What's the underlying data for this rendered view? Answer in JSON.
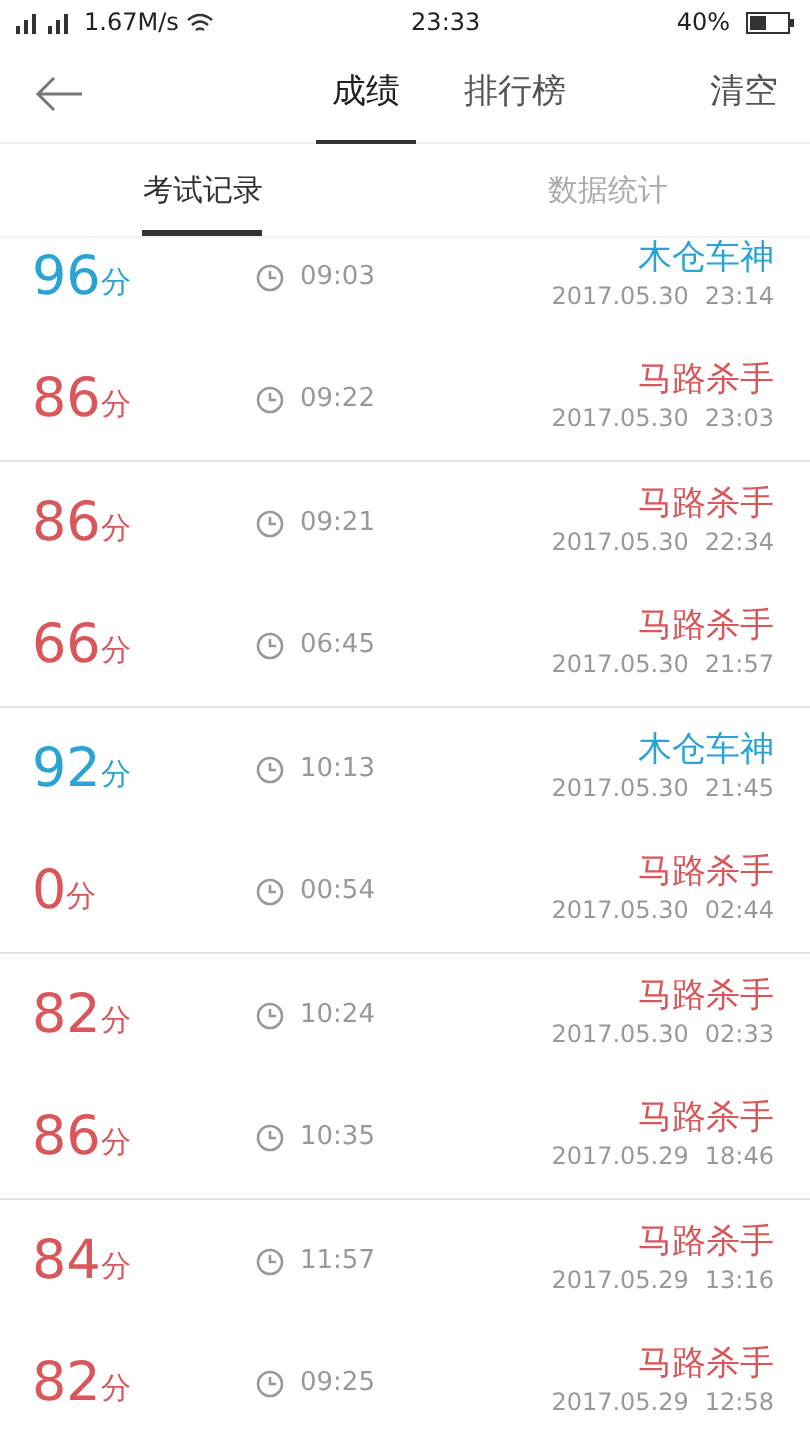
{
  "status_bar": {
    "speed": "1.67M/s",
    "time": "23:33",
    "battery": "40%"
  },
  "header": {
    "tabs": [
      {
        "label": "成绩",
        "selected": true
      },
      {
        "label": "排行榜",
        "selected": false
      }
    ],
    "action": "清空"
  },
  "sub_tabs": [
    {
      "label": "考试记录",
      "selected": true
    },
    {
      "label": "数据统计",
      "selected": false
    }
  ],
  "groups": [
    [
      {
        "score": "96",
        "unit": "分",
        "duration": "09:03",
        "name": "木仓车神",
        "date": "2017.05.30",
        "time": "23:14",
        "color": "#2ba3d4"
      },
      {
        "score": "86",
        "unit": "分",
        "duration": "09:22",
        "name": "马路杀手",
        "date": "2017.05.30",
        "time": "23:03",
        "color": "#d9575a"
      }
    ],
    [
      {
        "score": "86",
        "unit": "分",
        "duration": "09:21",
        "name": "马路杀手",
        "date": "2017.05.30",
        "time": "22:34",
        "color": "#d9575a"
      },
      {
        "score": "66",
        "unit": "分",
        "duration": "06:45",
        "name": "马路杀手",
        "date": "2017.05.30",
        "time": "21:57",
        "color": "#d9575a"
      }
    ],
    [
      {
        "score": "92",
        "unit": "分",
        "duration": "10:13",
        "name": "木仓车神",
        "date": "2017.05.30",
        "time": "21:45",
        "color": "#2ba3d4"
      },
      {
        "score": "0",
        "unit": "分",
        "duration": "00:54",
        "name": "马路杀手",
        "date": "2017.05.30",
        "time": "02:44",
        "color": "#d9575a"
      }
    ],
    [
      {
        "score": "82",
        "unit": "分",
        "duration": "10:24",
        "name": "马路杀手",
        "date": "2017.05.30",
        "time": "02:33",
        "color": "#d9575a"
      },
      {
        "score": "86",
        "unit": "分",
        "duration": "10:35",
        "name": "马路杀手",
        "date": "2017.05.29",
        "time": "18:46",
        "color": "#d9575a"
      }
    ],
    [
      {
        "score": "84",
        "unit": "分",
        "duration": "11:57",
        "name": "马路杀手",
        "date": "2017.05.29",
        "time": "13:16",
        "color": "#d9575a"
      },
      {
        "score": "82",
        "unit": "分",
        "duration": "09:25",
        "name": "马路杀手",
        "date": "2017.05.29",
        "time": "12:58",
        "color": "#d9575a"
      }
    ]
  ]
}
